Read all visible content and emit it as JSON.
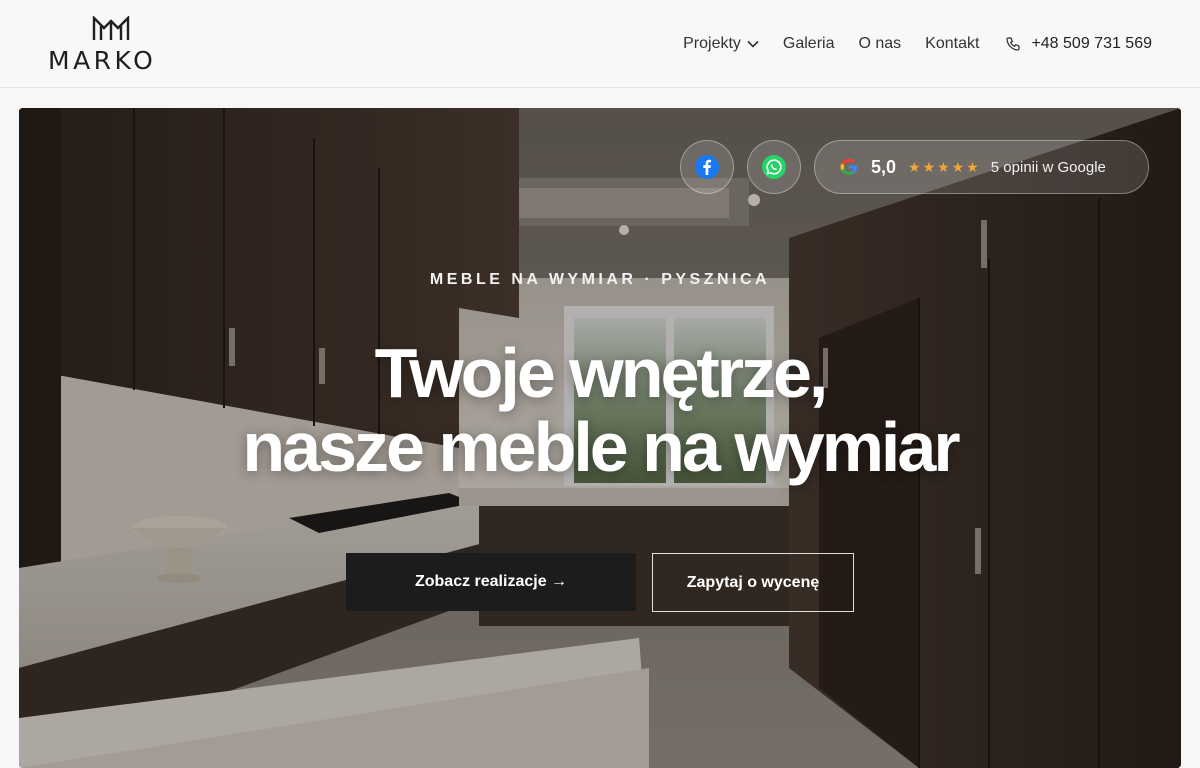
{
  "brand": {
    "name": "MARKO"
  },
  "nav": {
    "items": [
      {
        "label": "Projekty"
      },
      {
        "label": "Galeria"
      },
      {
        "label": "O nas"
      },
      {
        "label": "Kontakt"
      }
    ],
    "phone": "+48 509 731 569"
  },
  "hero": {
    "rating": {
      "score": "5,0",
      "stars": "★★★★★",
      "reviews": "5 opinii w Google"
    },
    "eyebrow": "MEBLE NA WYMIAR · PYSZNICA",
    "title_line1": "Twoje wnętrze,",
    "title_line2": "nasze meble na wymiar",
    "primary_button": "Zobacz realizacje →",
    "secondary_button": "Zapytaj o wycenę"
  },
  "colors": {
    "accent_star": "#f0a73a",
    "dark_button": "#1c1c1c",
    "facebook": "#1877f2",
    "whatsapp": "#25d366"
  }
}
